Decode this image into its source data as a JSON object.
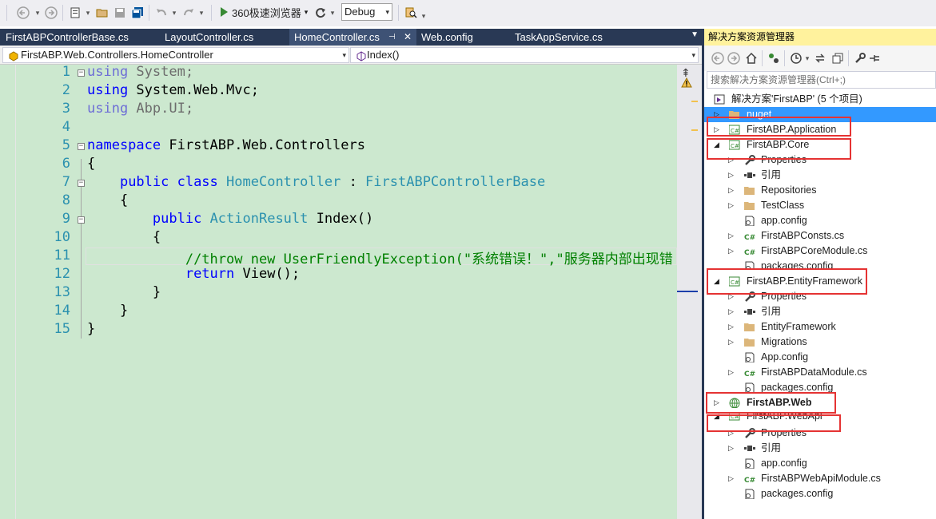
{
  "toolbar": {
    "run_label": "360极速浏览器",
    "config_value": "Debug"
  },
  "tabs": [
    {
      "label": "FirstABPControllerBase.cs"
    },
    {
      "label": "LayoutController.cs"
    },
    {
      "label": "HomeController.cs",
      "active": true
    },
    {
      "label": "Web.config"
    },
    {
      "label": "TaskAppService.cs"
    }
  ],
  "navbar": {
    "type_selector": "FirstABP.Web.Controllers.HomeController",
    "member_selector": "Index()"
  },
  "editor": {
    "line_numbers": [
      "1",
      "2",
      "3",
      "4",
      "5",
      "6",
      "7",
      "8",
      "9",
      "10",
      "11",
      "12",
      "13",
      "14",
      "15"
    ],
    "lines": {
      "l1_kw": "using",
      "l1_rest": " System;",
      "l2_kw": "using",
      "l2_rest": " System.Web.Mvc;",
      "l3_kw": "using",
      "l3_rest": " Abp.UI;",
      "l5_kw": "namespace",
      "l5_rest": " FirstABP.Web.Controllers",
      "l6": "{",
      "l7_kw": "public class",
      "l7_type": "HomeController",
      "l7_sep": " : ",
      "l7_base": "FirstABPControllerBase",
      "l8": "{",
      "l9_kw": "public",
      "l9_type": "ActionResult",
      "l9_rest": " Index()",
      "l10": "{",
      "l11_comment": "//throw new UserFriendlyException(\"系统错误！\",\"服务器内部出现错",
      "l12_kw": "return",
      "l12_rest": " View();",
      "l13": "}",
      "l14": "}",
      "l15": "}"
    }
  },
  "solution_explorer": {
    "title": "解决方案资源管理器",
    "search_placeholder": "搜索解决方案资源管理器(Ctrl+;)",
    "items": {
      "solution": "解决方案'FirstABP' (5 个项目)",
      "nuget": "nuget",
      "application": "FirstABP.Application",
      "core": "FirstABP.Core",
      "core_properties": "Properties",
      "core_refs": "引用",
      "core_repositories": "Repositories",
      "core_testclass": "TestClass",
      "core_appconfig": "app.config",
      "core_consts": "FirstABPConsts.cs",
      "core_module": "FirstABPCoreModule.cs",
      "core_packages": "packages.config",
      "ef": "FirstABP.EntityFramework",
      "ef_properties": "Properties",
      "ef_refs": "引用",
      "ef_entityframework": "EntityFramework",
      "ef_migrations": "Migrations",
      "ef_appconfig": "App.config",
      "ef_module": "FirstABPDataModule.cs",
      "ef_packages": "packages.config",
      "web": "FirstABP.Web",
      "webapi": "FirstABP.WebApi",
      "webapi_properties": "Properties",
      "webapi_refs": "引用",
      "webapi_appconfig": "app.config",
      "webapi_module": "FirstABPWebApiModule.cs",
      "webapi_packages": "packages.config"
    }
  },
  "icons": {
    "back": "back-arrow-icon",
    "forward": "forward-arrow-icon",
    "new_project": "new-project-icon",
    "open": "open-folder-icon",
    "save": "save-icon",
    "save_all": "save-all-icon",
    "undo": "undo-icon",
    "redo": "redo-icon",
    "run": "run-icon",
    "refresh": "refresh-icon"
  }
}
